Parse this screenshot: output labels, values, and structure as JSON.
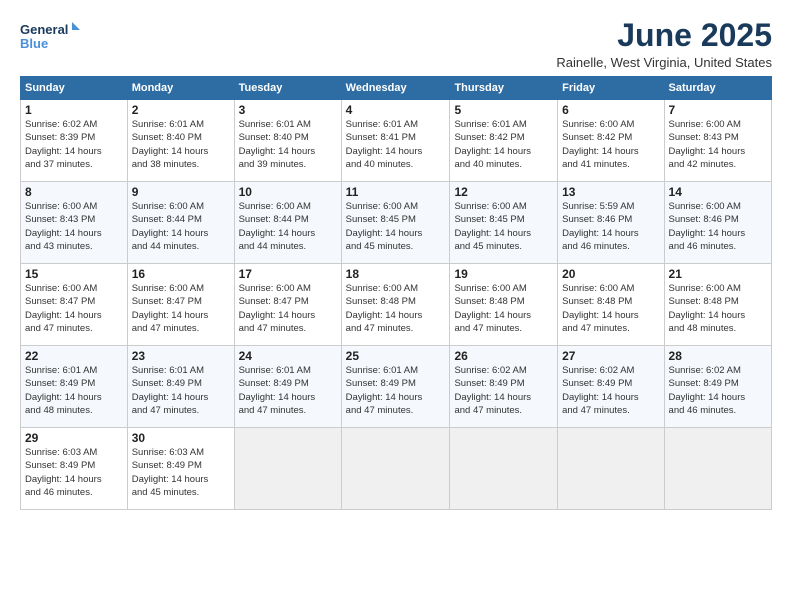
{
  "header": {
    "logo_line1": "General",
    "logo_line2": "Blue",
    "title": "June 2025",
    "subtitle": "Rainelle, West Virginia, United States"
  },
  "days_of_week": [
    "Sunday",
    "Monday",
    "Tuesday",
    "Wednesday",
    "Thursday",
    "Friday",
    "Saturday"
  ],
  "weeks": [
    [
      {
        "day": "1",
        "detail": "Sunrise: 6:02 AM\nSunset: 8:39 PM\nDaylight: 14 hours\nand 37 minutes."
      },
      {
        "day": "2",
        "detail": "Sunrise: 6:01 AM\nSunset: 8:40 PM\nDaylight: 14 hours\nand 38 minutes."
      },
      {
        "day": "3",
        "detail": "Sunrise: 6:01 AM\nSunset: 8:40 PM\nDaylight: 14 hours\nand 39 minutes."
      },
      {
        "day": "4",
        "detail": "Sunrise: 6:01 AM\nSunset: 8:41 PM\nDaylight: 14 hours\nand 40 minutes."
      },
      {
        "day": "5",
        "detail": "Sunrise: 6:01 AM\nSunset: 8:42 PM\nDaylight: 14 hours\nand 40 minutes."
      },
      {
        "day": "6",
        "detail": "Sunrise: 6:00 AM\nSunset: 8:42 PM\nDaylight: 14 hours\nand 41 minutes."
      },
      {
        "day": "7",
        "detail": "Sunrise: 6:00 AM\nSunset: 8:43 PM\nDaylight: 14 hours\nand 42 minutes."
      }
    ],
    [
      {
        "day": "8",
        "detail": "Sunrise: 6:00 AM\nSunset: 8:43 PM\nDaylight: 14 hours\nand 43 minutes."
      },
      {
        "day": "9",
        "detail": "Sunrise: 6:00 AM\nSunset: 8:44 PM\nDaylight: 14 hours\nand 44 minutes."
      },
      {
        "day": "10",
        "detail": "Sunrise: 6:00 AM\nSunset: 8:44 PM\nDaylight: 14 hours\nand 44 minutes."
      },
      {
        "day": "11",
        "detail": "Sunrise: 6:00 AM\nSunset: 8:45 PM\nDaylight: 14 hours\nand 45 minutes."
      },
      {
        "day": "12",
        "detail": "Sunrise: 6:00 AM\nSunset: 8:45 PM\nDaylight: 14 hours\nand 45 minutes."
      },
      {
        "day": "13",
        "detail": "Sunrise: 5:59 AM\nSunset: 8:46 PM\nDaylight: 14 hours\nand 46 minutes."
      },
      {
        "day": "14",
        "detail": "Sunrise: 6:00 AM\nSunset: 8:46 PM\nDaylight: 14 hours\nand 46 minutes."
      }
    ],
    [
      {
        "day": "15",
        "detail": "Sunrise: 6:00 AM\nSunset: 8:47 PM\nDaylight: 14 hours\nand 47 minutes."
      },
      {
        "day": "16",
        "detail": "Sunrise: 6:00 AM\nSunset: 8:47 PM\nDaylight: 14 hours\nand 47 minutes."
      },
      {
        "day": "17",
        "detail": "Sunrise: 6:00 AM\nSunset: 8:47 PM\nDaylight: 14 hours\nand 47 minutes."
      },
      {
        "day": "18",
        "detail": "Sunrise: 6:00 AM\nSunset: 8:48 PM\nDaylight: 14 hours\nand 47 minutes."
      },
      {
        "day": "19",
        "detail": "Sunrise: 6:00 AM\nSunset: 8:48 PM\nDaylight: 14 hours\nand 47 minutes."
      },
      {
        "day": "20",
        "detail": "Sunrise: 6:00 AM\nSunset: 8:48 PM\nDaylight: 14 hours\nand 47 minutes."
      },
      {
        "day": "21",
        "detail": "Sunrise: 6:00 AM\nSunset: 8:48 PM\nDaylight: 14 hours\nand 48 minutes."
      }
    ],
    [
      {
        "day": "22",
        "detail": "Sunrise: 6:01 AM\nSunset: 8:49 PM\nDaylight: 14 hours\nand 48 minutes."
      },
      {
        "day": "23",
        "detail": "Sunrise: 6:01 AM\nSunset: 8:49 PM\nDaylight: 14 hours\nand 47 minutes."
      },
      {
        "day": "24",
        "detail": "Sunrise: 6:01 AM\nSunset: 8:49 PM\nDaylight: 14 hours\nand 47 minutes."
      },
      {
        "day": "25",
        "detail": "Sunrise: 6:01 AM\nSunset: 8:49 PM\nDaylight: 14 hours\nand 47 minutes."
      },
      {
        "day": "26",
        "detail": "Sunrise: 6:02 AM\nSunset: 8:49 PM\nDaylight: 14 hours\nand 47 minutes."
      },
      {
        "day": "27",
        "detail": "Sunrise: 6:02 AM\nSunset: 8:49 PM\nDaylight: 14 hours\nand 47 minutes."
      },
      {
        "day": "28",
        "detail": "Sunrise: 6:02 AM\nSunset: 8:49 PM\nDaylight: 14 hours\nand 46 minutes."
      }
    ],
    [
      {
        "day": "29",
        "detail": "Sunrise: 6:03 AM\nSunset: 8:49 PM\nDaylight: 14 hours\nand 46 minutes."
      },
      {
        "day": "30",
        "detail": "Sunrise: 6:03 AM\nSunset: 8:49 PM\nDaylight: 14 hours\nand 45 minutes."
      },
      {
        "day": "",
        "detail": ""
      },
      {
        "day": "",
        "detail": ""
      },
      {
        "day": "",
        "detail": ""
      },
      {
        "day": "",
        "detail": ""
      },
      {
        "day": "",
        "detail": ""
      }
    ]
  ]
}
